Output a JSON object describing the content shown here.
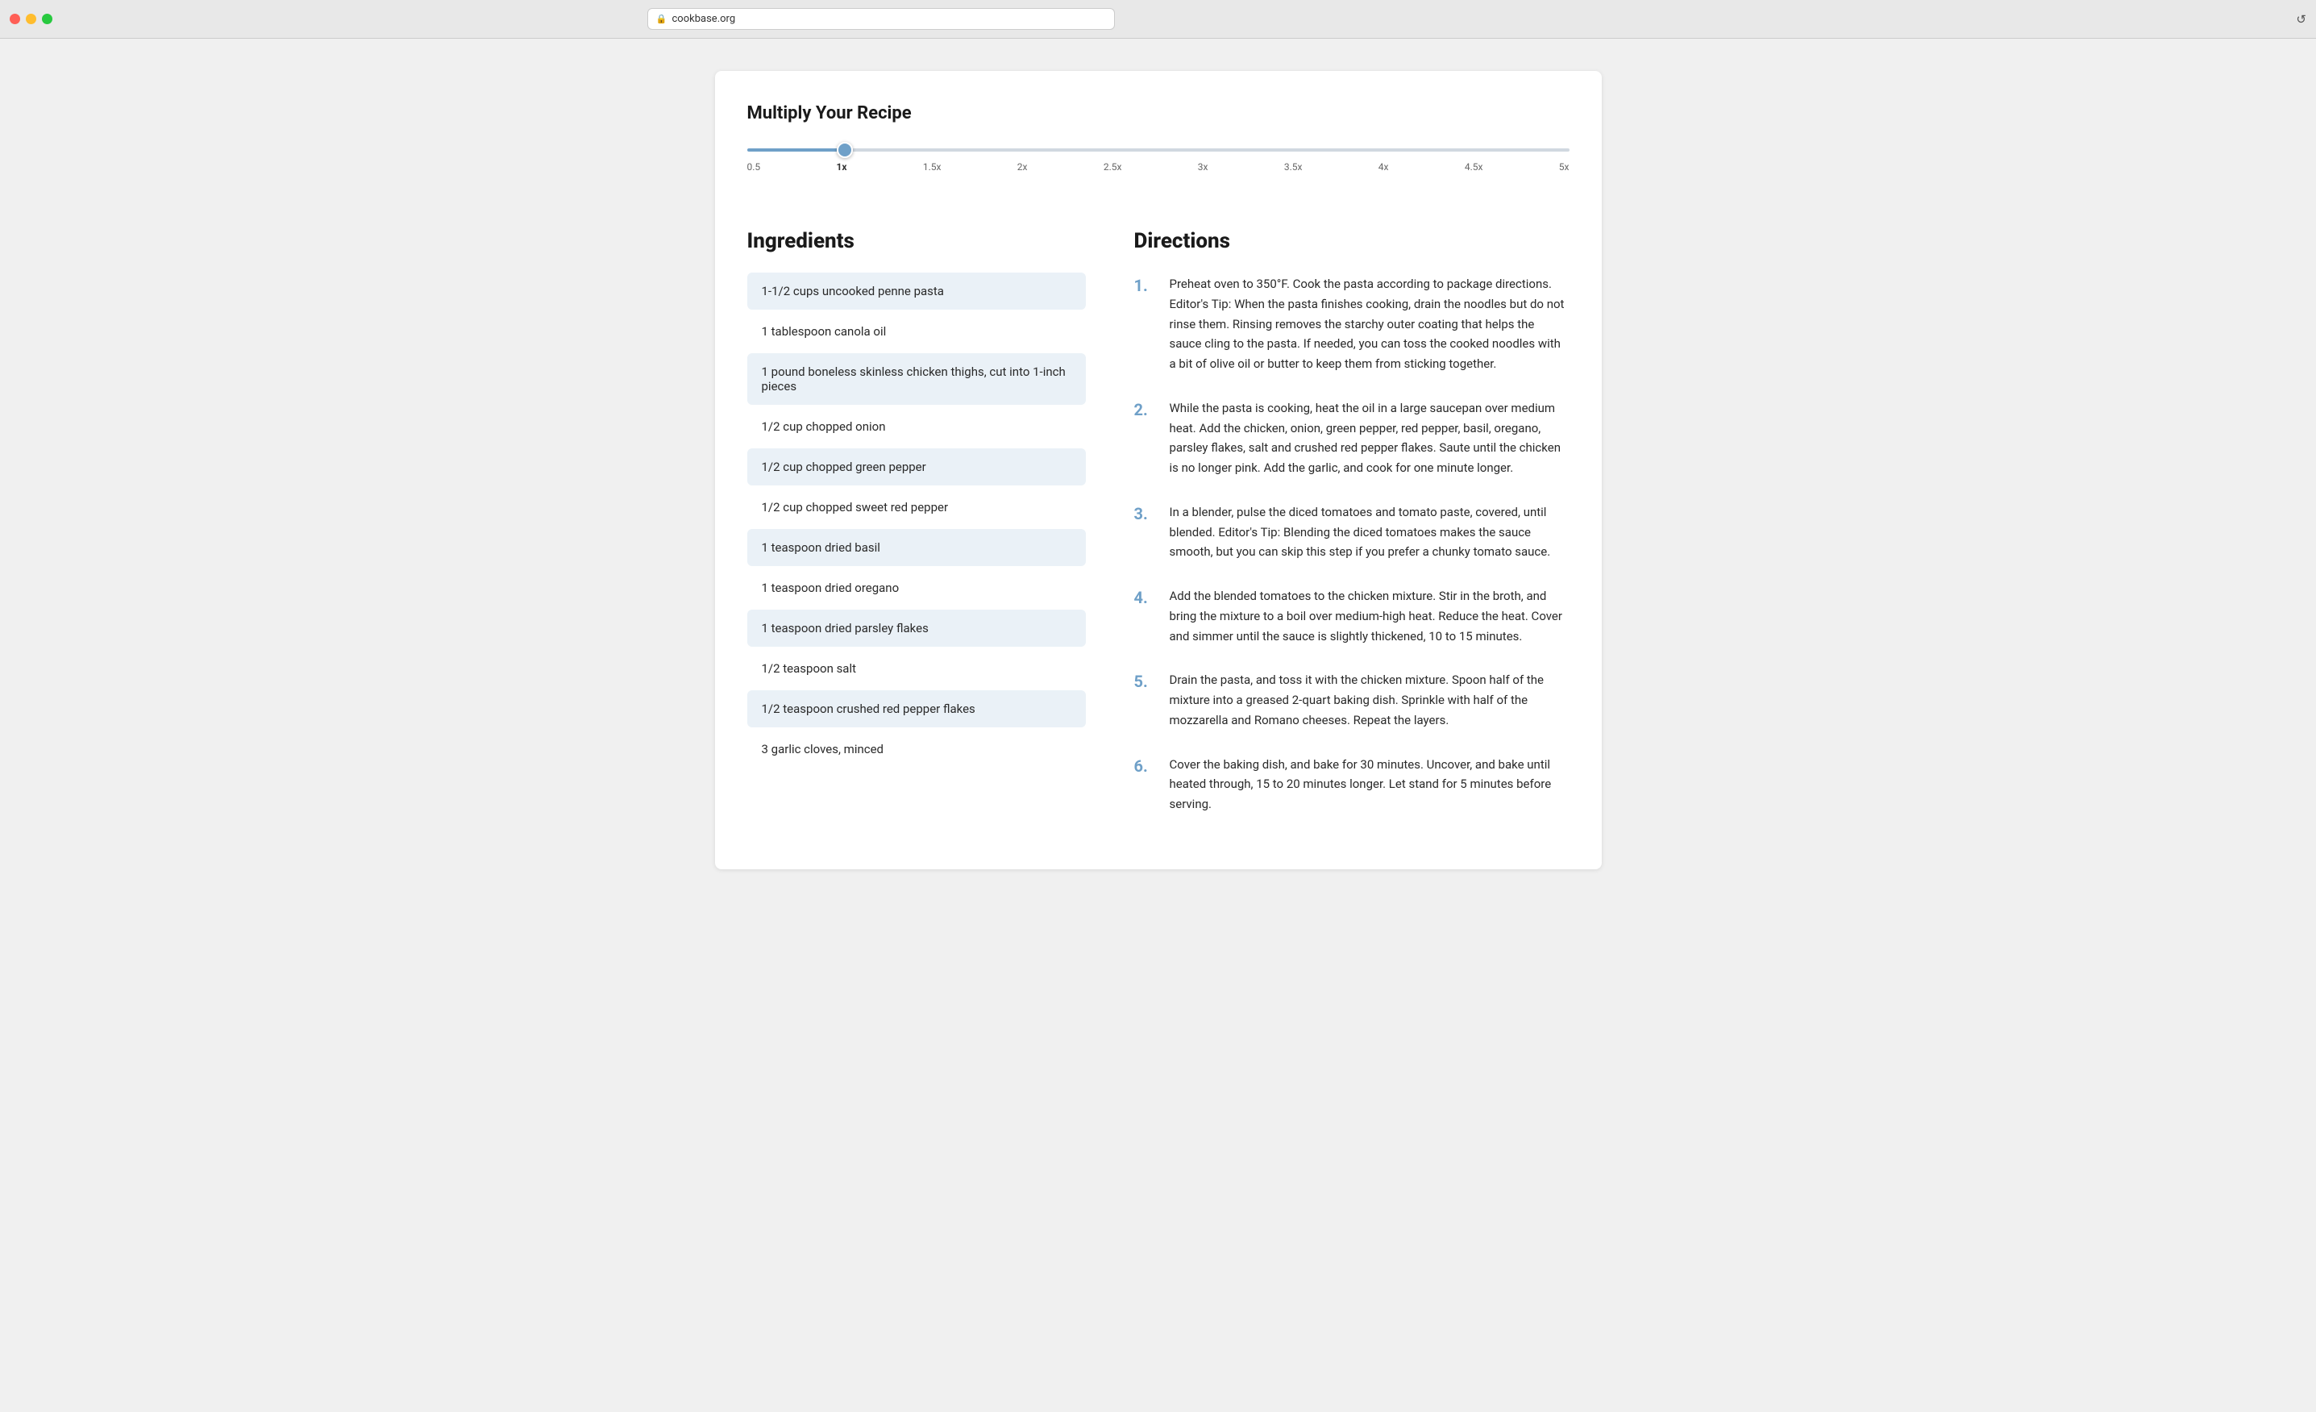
{
  "browser": {
    "url": "cookbase.org",
    "reload_icon": "↺"
  },
  "multiply": {
    "title": "Multiply Your Recipe",
    "slider_min": 0.5,
    "slider_max": 5,
    "slider_value": 1,
    "slider_step": 0.5,
    "labels": [
      "0.5",
      "1x",
      "1.5x",
      "2x",
      "2.5x",
      "3x",
      "3.5x",
      "4x",
      "4.5x",
      "5x"
    ]
  },
  "ingredients": {
    "title": "Ingredients",
    "items": [
      "1-1/2 cups uncooked penne pasta",
      "1 tablespoon canola oil",
      "1 pound boneless skinless chicken thighs, cut into 1-inch pieces",
      "1/2 cup chopped onion",
      "1/2 cup chopped green pepper",
      "1/2 cup chopped sweet red pepper",
      "1 teaspoon dried basil",
      "1 teaspoon dried oregano",
      "1 teaspoon dried parsley flakes",
      "1/2 teaspoon salt",
      "1/2 teaspoon crushed red pepper flakes",
      "3 garlic cloves, minced"
    ]
  },
  "directions": {
    "title": "Directions",
    "steps": [
      "Preheat oven to 350°F. Cook the pasta according to package directions. Editor's Tip: When the pasta finishes cooking, drain the noodles but do not rinse them. Rinsing removes the starchy outer coating that helps the sauce cling to the pasta. If needed, you can toss the cooked noodles with a bit of olive oil or butter to keep them from sticking together.",
      "While the pasta is cooking, heat the oil in a large saucepan over medium heat. Add the chicken, onion, green pepper, red pepper, basil, oregano, parsley flakes, salt and crushed red pepper flakes. Saute until the chicken is no longer pink. Add the garlic, and cook for one minute longer.",
      "In a blender, pulse the diced tomatoes and tomato paste, covered, until blended. Editor's Tip: Blending the diced tomatoes makes the sauce smooth, but you can skip this step if you prefer a chunky tomato sauce.",
      "Add the blended tomatoes to the chicken mixture. Stir in the broth, and bring the mixture to a boil over medium-high heat. Reduce the heat. Cover and simmer until the sauce is slightly thickened, 10 to 15 minutes.",
      "Drain the pasta, and toss it with the chicken mixture. Spoon half of the mixture into a greased 2-quart baking dish. Sprinkle with half of the mozzarella and Romano cheeses. Repeat the layers.",
      "Cover the baking dish, and bake for 30 minutes. Uncover, and bake until heated through, 15 to 20 minutes longer. Let stand for 5 minutes before serving."
    ],
    "step_numbers": [
      "1.",
      "2.",
      "3.",
      "4.",
      "5.",
      "6."
    ]
  }
}
